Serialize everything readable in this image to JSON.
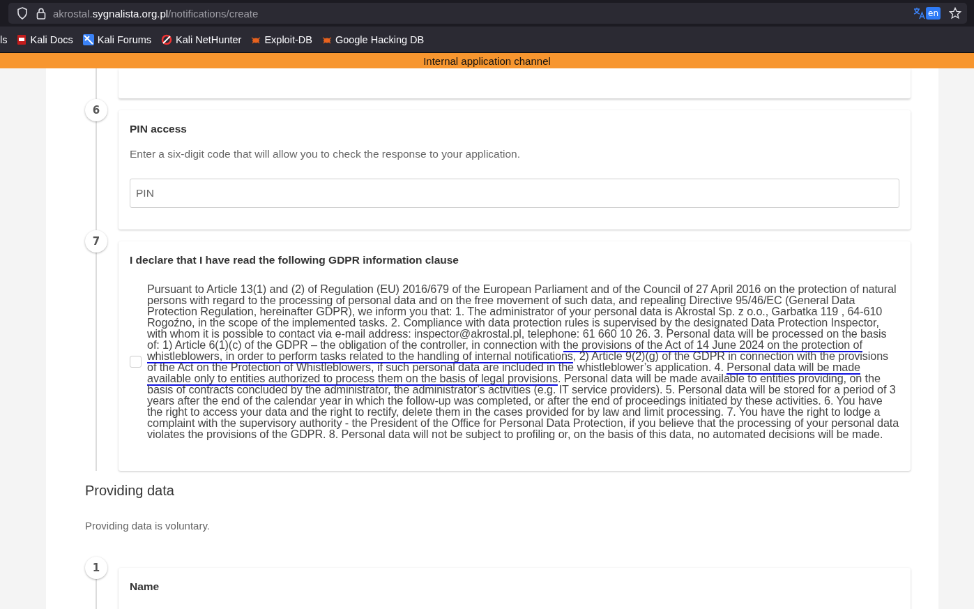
{
  "browser": {
    "url": {
      "subdomain": "akrostal.",
      "domain": "sygnalista.org.pl",
      "path": "/notifications/create"
    },
    "translate_badge": "en",
    "bookmarks": [
      {
        "label": "ls",
        "kind": "none"
      },
      {
        "label": "Kali Docs",
        "kind": "docs"
      },
      {
        "label": "Kali Forums",
        "kind": "forums"
      },
      {
        "label": "Kali NetHunter",
        "kind": "nethunter"
      },
      {
        "label": "Exploit-DB",
        "kind": "bug"
      },
      {
        "label": "Google Hacking DB",
        "kind": "bug"
      }
    ]
  },
  "banner": "Internal application channel",
  "steps": [
    {
      "number": "6",
      "title": "PIN access",
      "description": "Enter a six-digit code that will allow you to check the response to your application.",
      "field": {
        "placeholder": "PIN"
      }
    },
    {
      "number": "7",
      "title": "I declare that I have read the following GDPR information clause",
      "checkbox": {
        "checked": false
      },
      "clause": [
        {
          "text": "Pursuant to Article 13(1) and (2) of Regulation (EU) 2016/679 of the European Parliament and of the Council of 27 April 2016 on the protection of natural persons with regard to the processing of personal data and on the free movement of such data, and repealing Directive 95/46/EC (General Data Protection Regulation, hereinafter GDPR), we inform you that: 1. The administrator of your personal data is Akrostal Sp. z o.o., Garbatka 119 , 64-610 Rogoźno, in the scope of the implemented tasks. 2. Compliance with data protection rules is supervised by the designated Data Protection Inspector, with whom it is possible to contact via e-mail address: inspector@akrostal.pl, telephone: 61 660 10 26. 3. Personal data will be processed on the basis of: 1) Article 6(1)(c) of the GDPR – the obligation of the controller, in connection with ",
          "underlined": false
        },
        {
          "text": "the provisions of the Act of 14 June 2024 on the protection of whistleblowers, in order to perform tasks related to the handling of internal notifications",
          "underlined": true
        },
        {
          "text": ", 2) Article 9(2)(g) of the GDPR in connection with the provisions of the Act on the Protection of Whistleblowers, if such personal data are included in the whistleblower’s application. 4. ",
          "underlined": false
        },
        {
          "text": "Personal data will be made available only to entities authorized to process them on the basis of legal provisions",
          "underlined": true
        },
        {
          "text": ". Personal data will be made available to entities providing, on the basis of contracts concluded by the administrator, the administrator’s activities (e.g. IT service providers). 5. Personal data will be stored for a period of 3 years after the end of the calendar year in which the follow-up was completed, or after the end of proceedings initiated by these activities. 6. You have the right to access your data and the right to rectify, delete them in the cases provided for by law and limit processing. 7. You have the right to lodge a complaint with the supervisory authority - the President of the Office for Personal Data Protection, if you believe that the processing of your personal data violates the provisions of the GDPR. 8. Personal data will not be subject to profiling or, on the basis of this data, no automated decisions will be made.",
          "underlined": false
        }
      ]
    }
  ],
  "section": {
    "title": "Providing data",
    "note": "Providing data is voluntary.",
    "steps": [
      {
        "number": "1",
        "title": "Name"
      }
    ]
  }
}
